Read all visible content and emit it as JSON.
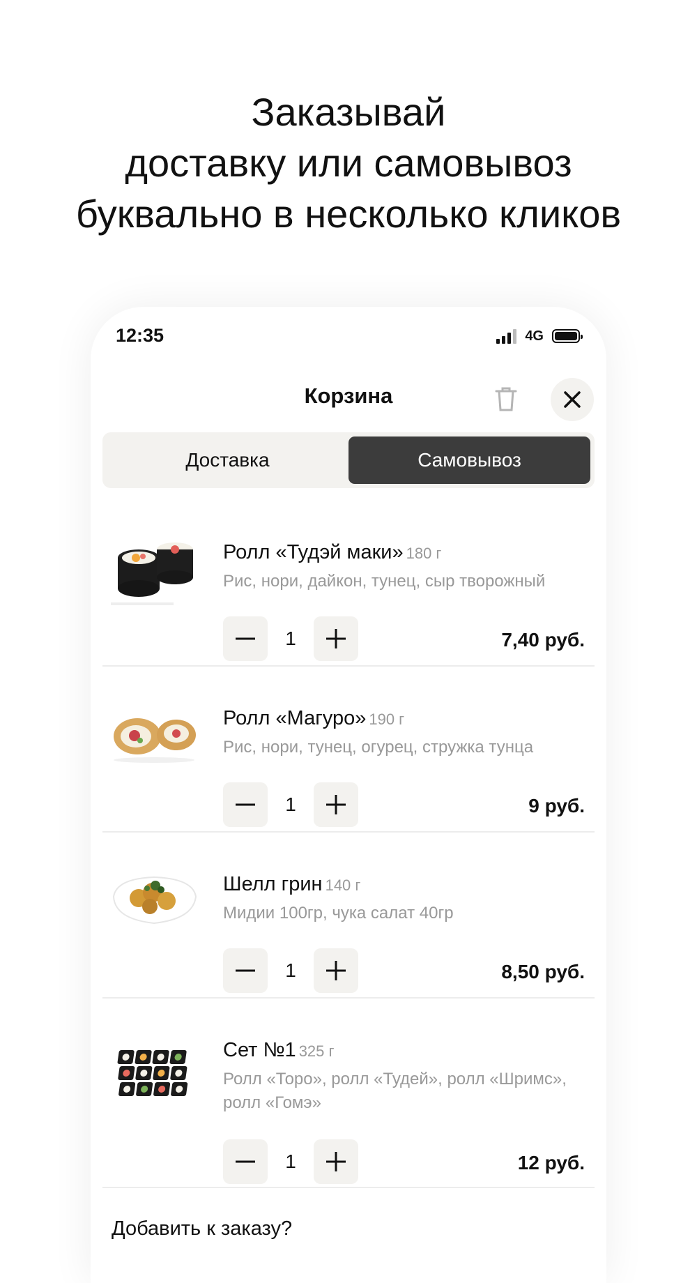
{
  "promo": {
    "line1": "Заказывай",
    "line2": "доставку или самовывоз",
    "line3": "буквально в несколько кликов"
  },
  "status_bar": {
    "time": "12:35",
    "network": "4G"
  },
  "header": {
    "title": "Корзина"
  },
  "tabs": [
    {
      "label": "Доставка",
      "active": false
    },
    {
      "label": "Самовывоз",
      "active": true
    }
  ],
  "cart_items": [
    {
      "name": "Ролл «Тудэй маки»",
      "weight": "180 г",
      "description": "Рис, нори, дайкон, тунец, сыр творожный",
      "quantity": "1",
      "price": "7,40 руб."
    },
    {
      "name": "Ролл «Магуро»",
      "weight": "190 г",
      "description": "Рис, нори, тунец, огурец, стружка тунца",
      "quantity": "1",
      "price": "9 руб."
    },
    {
      "name": "Шелл грин",
      "weight": "140 г",
      "description": "Мидии 100гр, чука салат 40гр",
      "quantity": "1",
      "price": "8,50 руб."
    },
    {
      "name": "Сет №1",
      "weight": "325 г",
      "description": "Ролл «Торо», ролл «Тудей», ролл «Шримс», ролл «Гомэ»",
      "quantity": "1",
      "price": "12 руб."
    }
  ],
  "add_more": "Добавить к заказу?",
  "colors": {
    "accent_dark": "#3c3c3c",
    "control_bg": "#f3f2ef",
    "muted_text": "#999999"
  }
}
